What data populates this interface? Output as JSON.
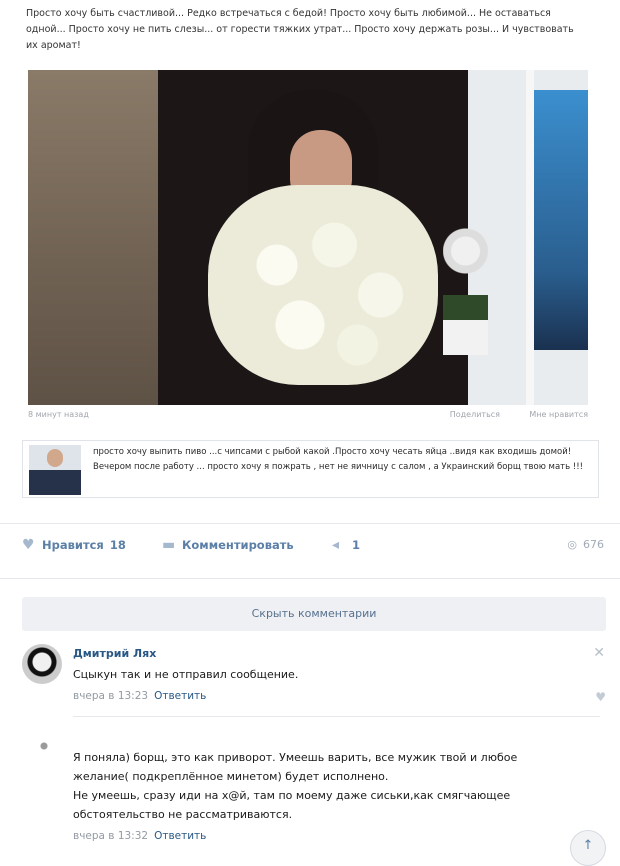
{
  "post": {
    "text": "Просто хочу быть счастливой... Редко встречаться с бедой! Просто хочу быть любимой... Не оставаться одной... Просто хочу не пить слезы... от горести тяжких утрат... Просто хочу держать розы... И чувствовать их аромат!",
    "time": "8 минут назад",
    "share_label": "Поделиться",
    "like_label": "Мне нравится"
  },
  "quote": {
    "text": "просто хочу выпить пиво ...с чипсами с рыбой какой .Просто хочу чесать яйца ..видя как входишь домой! Вечером после работу ... просто хочу я пожрать , нет не яичницу с салом , а Украинский борщ твою мать !!!"
  },
  "actions": {
    "like_label": "Нравится",
    "like_count": "18",
    "comment_label": "Комментировать",
    "share_count": "1",
    "views": "676"
  },
  "hide_comments_label": "Скрыть комментарии",
  "comments": [
    {
      "author": "Дмитрий Лях",
      "text": "Сцыкун так и не отправил сообщение.",
      "date": "вчера в 13:23",
      "reply": "Ответить"
    },
    {
      "author": "",
      "text_lines": [
        "Я поняла) борщ, это как приворот. Умеешь варить, все мужик твой и любое",
        "желание( подкреплённое минетом) будет исполнено.",
        "Не умеешь, сразу иди на х@й, там по моему даже сиськи,как смягчающее",
        "обстоятельство не рассматриваются."
      ],
      "date": "вчера в 13:32",
      "reply": "Ответить"
    }
  ],
  "colors": {
    "link": "#2a5885",
    "accent": "#5b7fa6",
    "muted": "#939aa3"
  }
}
